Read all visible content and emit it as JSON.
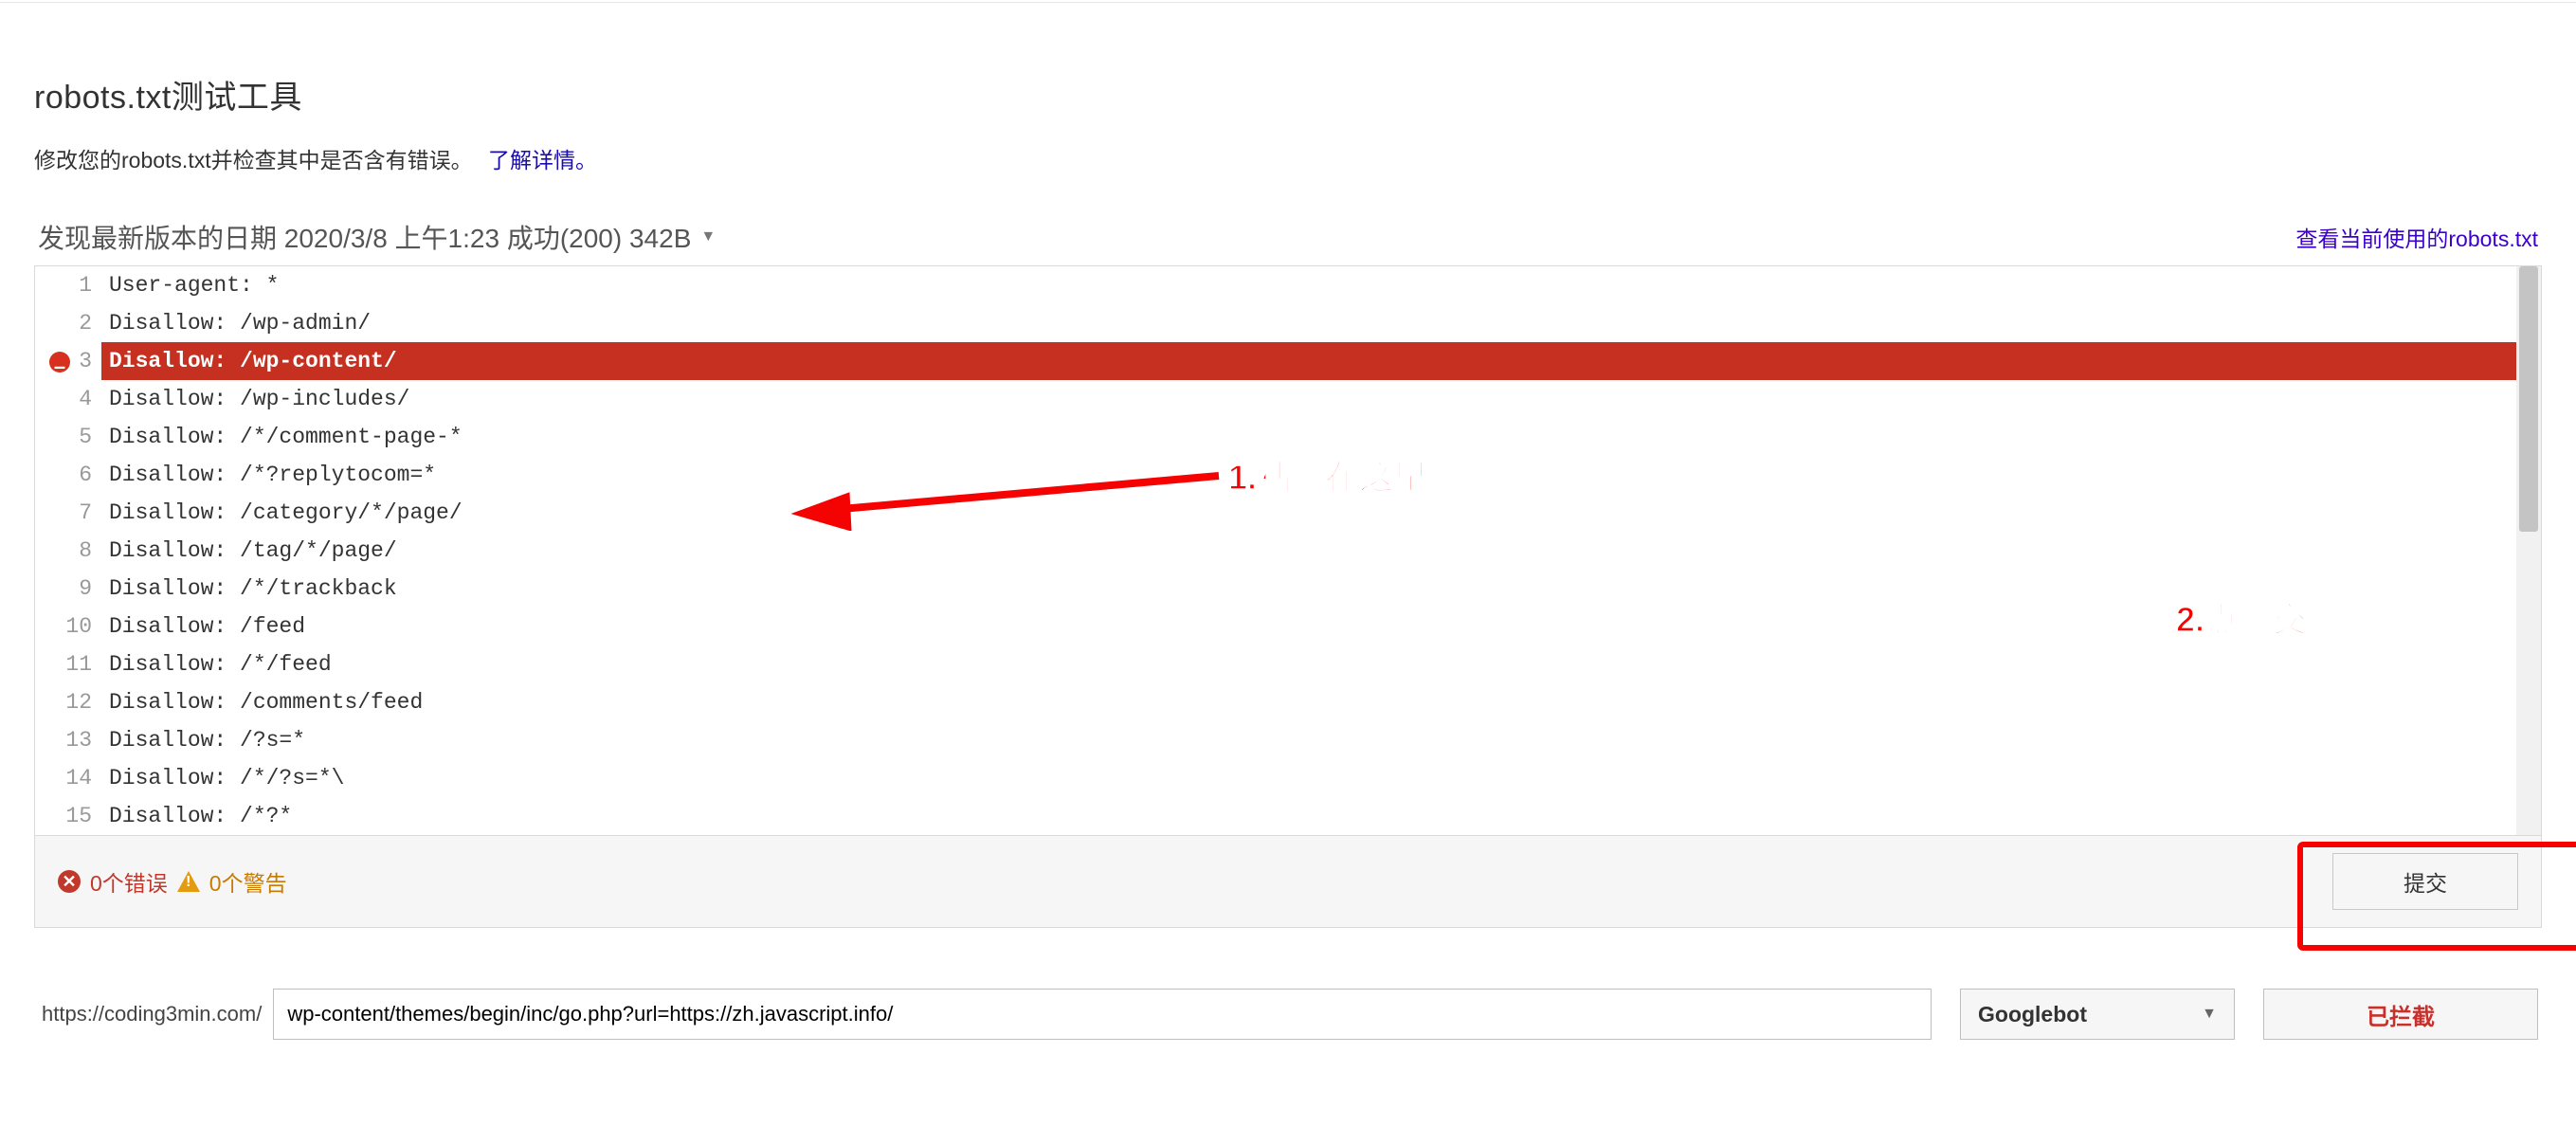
{
  "header": {
    "title": "robots.txt测试工具",
    "subtitle": "修改您的robots.txt并检查其中是否含有错误。",
    "learn_more_label": "了解详情。"
  },
  "status": {
    "latest_version_text": "发现最新版本的日期 2020/3/8 上午1:23 成功(200) 342B",
    "view_current_link": "查看当前使用的robots.txt"
  },
  "editor": {
    "lines": [
      {
        "n": 1,
        "text": "User-agent: *",
        "error": false
      },
      {
        "n": 2,
        "text": "Disallow: /wp-admin/",
        "error": false
      },
      {
        "n": 3,
        "text": "Disallow: /wp-content/",
        "error": true
      },
      {
        "n": 4,
        "text": "Disallow: /wp-includes/",
        "error": false
      },
      {
        "n": 5,
        "text": "Disallow: /*/comment-page-*",
        "error": false
      },
      {
        "n": 6,
        "text": "Disallow: /*?replytocom=*",
        "error": false
      },
      {
        "n": 7,
        "text": "Disallow: /category/*/page/",
        "error": false
      },
      {
        "n": 8,
        "text": "Disallow: /tag/*/page/",
        "error": false
      },
      {
        "n": 9,
        "text": "Disallow: /*/trackback",
        "error": false
      },
      {
        "n": 10,
        "text": "Disallow: /feed",
        "error": false
      },
      {
        "n": 11,
        "text": "Disallow: /*/feed",
        "error": false
      },
      {
        "n": 12,
        "text": "Disallow: /comments/feed",
        "error": false
      },
      {
        "n": 13,
        "text": "Disallow: /?s=*",
        "error": false
      },
      {
        "n": 14,
        "text": "Disallow: /*/?s=*\\",
        "error": false
      },
      {
        "n": 15,
        "text": "Disallow: /*?*",
        "error": false
      }
    ]
  },
  "footer": {
    "error_count_label": "0个错误",
    "warning_count_label": "0个警告",
    "submit_label": "提交"
  },
  "tester": {
    "url_prefix": "https://coding3min.com/",
    "url_path_value": "wp-content/themes/begin/inc/go.php?url=https://zh.javascript.info/",
    "bot_selected": "Googlebot",
    "result_label": "已拦截"
  },
  "annotations": {
    "step1": "1.粘贴在这里",
    "step2": "2.点提交"
  }
}
